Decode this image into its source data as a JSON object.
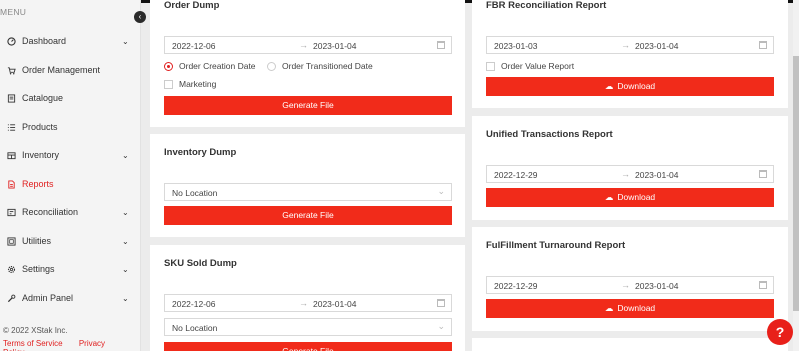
{
  "sidebar": {
    "menu_label": "MENU",
    "items": [
      {
        "label": "Dashboard",
        "chevron": true
      },
      {
        "label": "Order Management",
        "chevron": false
      },
      {
        "label": "Catalogue",
        "chevron": false
      },
      {
        "label": "Products",
        "chevron": false
      },
      {
        "label": "Inventory",
        "chevron": true
      },
      {
        "label": "Reports",
        "chevron": false,
        "active": true
      },
      {
        "label": "Reconciliation",
        "chevron": true
      },
      {
        "label": "Utilities",
        "chevron": true
      },
      {
        "label": "Settings",
        "chevron": true
      },
      {
        "label": "Admin Panel",
        "chevron": true
      }
    ],
    "copyright": "© 2022 XStak Inc.",
    "terms": "Terms of Service",
    "privacy": "Privacy Policy"
  },
  "order_dump": {
    "title": "Order Dump",
    "start": "2022-12-06",
    "end": "2023-01-04",
    "radio_creation": "Order Creation Date",
    "radio_transitioned": "Order Transitioned Date",
    "marketing": "Marketing",
    "button": "Generate File"
  },
  "inventory_dump": {
    "title": "Inventory Dump",
    "location": "No Location",
    "button": "Generate File"
  },
  "sku_sold_dump": {
    "title": "SKU Sold Dump",
    "start": "2022-12-06",
    "end": "2023-01-04",
    "location": "No Location",
    "button": "Generate File"
  },
  "fbr_report": {
    "title": "FBR Reconciliation Report",
    "start": "2023-01-03",
    "end": "2023-01-04",
    "order_value": "Order Value Report",
    "button": "Download"
  },
  "unified_report": {
    "title": "Unified Transactions Report",
    "start": "2022-12-29",
    "end": "2023-01-04",
    "button": "Download"
  },
  "fulfillment_report": {
    "title": "FulFillment Turnaround Report",
    "start": "2022-12-29",
    "end": "2023-01-04",
    "button": "Download"
  },
  "help_label": "?",
  "colors": {
    "accent": "#f12b1a",
    "active": "#e02020"
  }
}
